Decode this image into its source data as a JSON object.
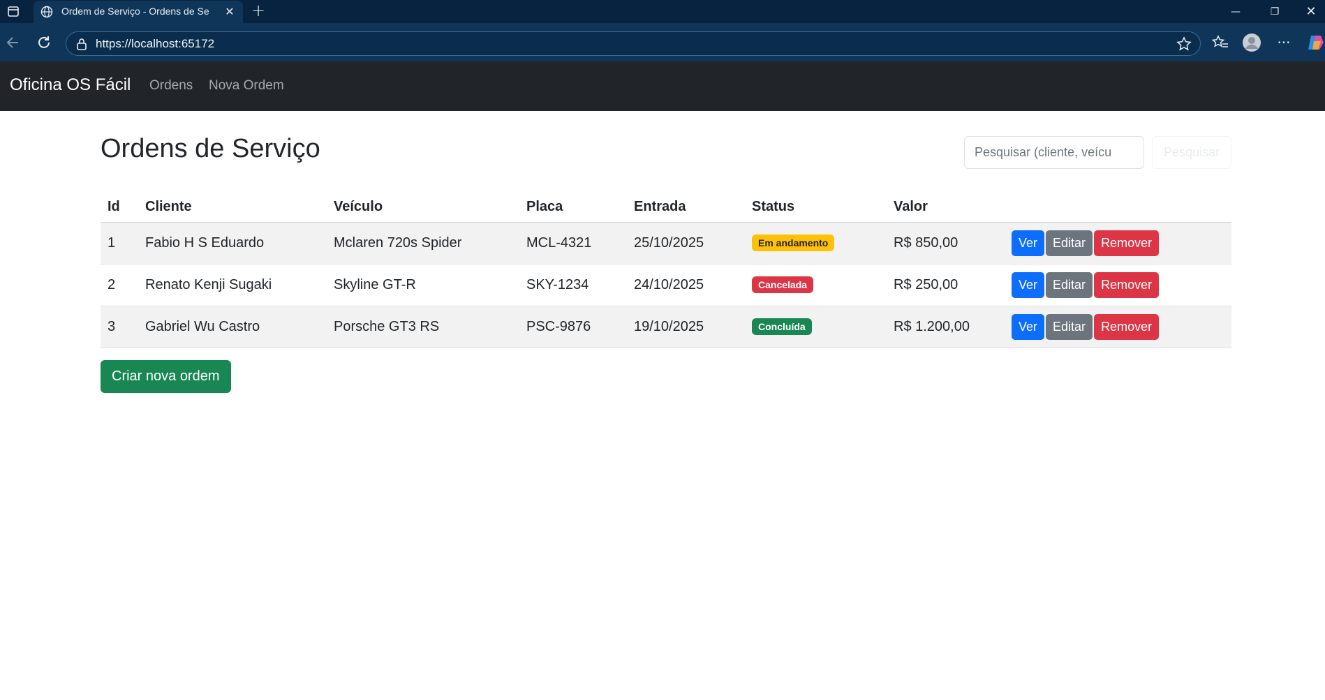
{
  "browser": {
    "tab_title": "Ordem de Serviço - Ordens de Se",
    "url": "https://localhost:65172"
  },
  "navbar": {
    "brand": "Oficina OS Fácil",
    "links": [
      "Ordens",
      "Nova Ordem"
    ]
  },
  "main": {
    "title": "Ordens de Serviço",
    "search_placeholder": "Pesquisar (cliente, veícu",
    "search_button": "Pesquisar",
    "create_button": "Criar nova ordem"
  },
  "table": {
    "headers": [
      "Id",
      "Cliente",
      "Veículo",
      "Placa",
      "Entrada",
      "Status",
      "Valor",
      ""
    ],
    "rows": [
      {
        "id": "1",
        "cliente": "Fabio H S Eduardo",
        "veiculo": "Mclaren 720s Spider",
        "placa": "MCL-4321",
        "entrada": "25/10/2025",
        "status": "Em andamento",
        "status_color": "#ffc107",
        "valor": "R$ 850,00"
      },
      {
        "id": "2",
        "cliente": "Renato Kenji Sugaki",
        "veiculo": "Skyline GT-R",
        "placa": "SKY-1234",
        "entrada": "24/10/2025",
        "status": "Cancelada",
        "status_color": "#dc3545",
        "valor": "R$ 250,00"
      },
      {
        "id": "3",
        "cliente": "Gabriel Wu Castro",
        "veiculo": "Porsche GT3 RS",
        "placa": "PSC-9876",
        "entrada": "19/10/2025",
        "status": "Concluída",
        "status_color": "#198754",
        "valor": "R$ 1.200,00"
      }
    ],
    "actions": {
      "view": "Ver",
      "edit": "Editar",
      "remove": "Remover"
    }
  }
}
